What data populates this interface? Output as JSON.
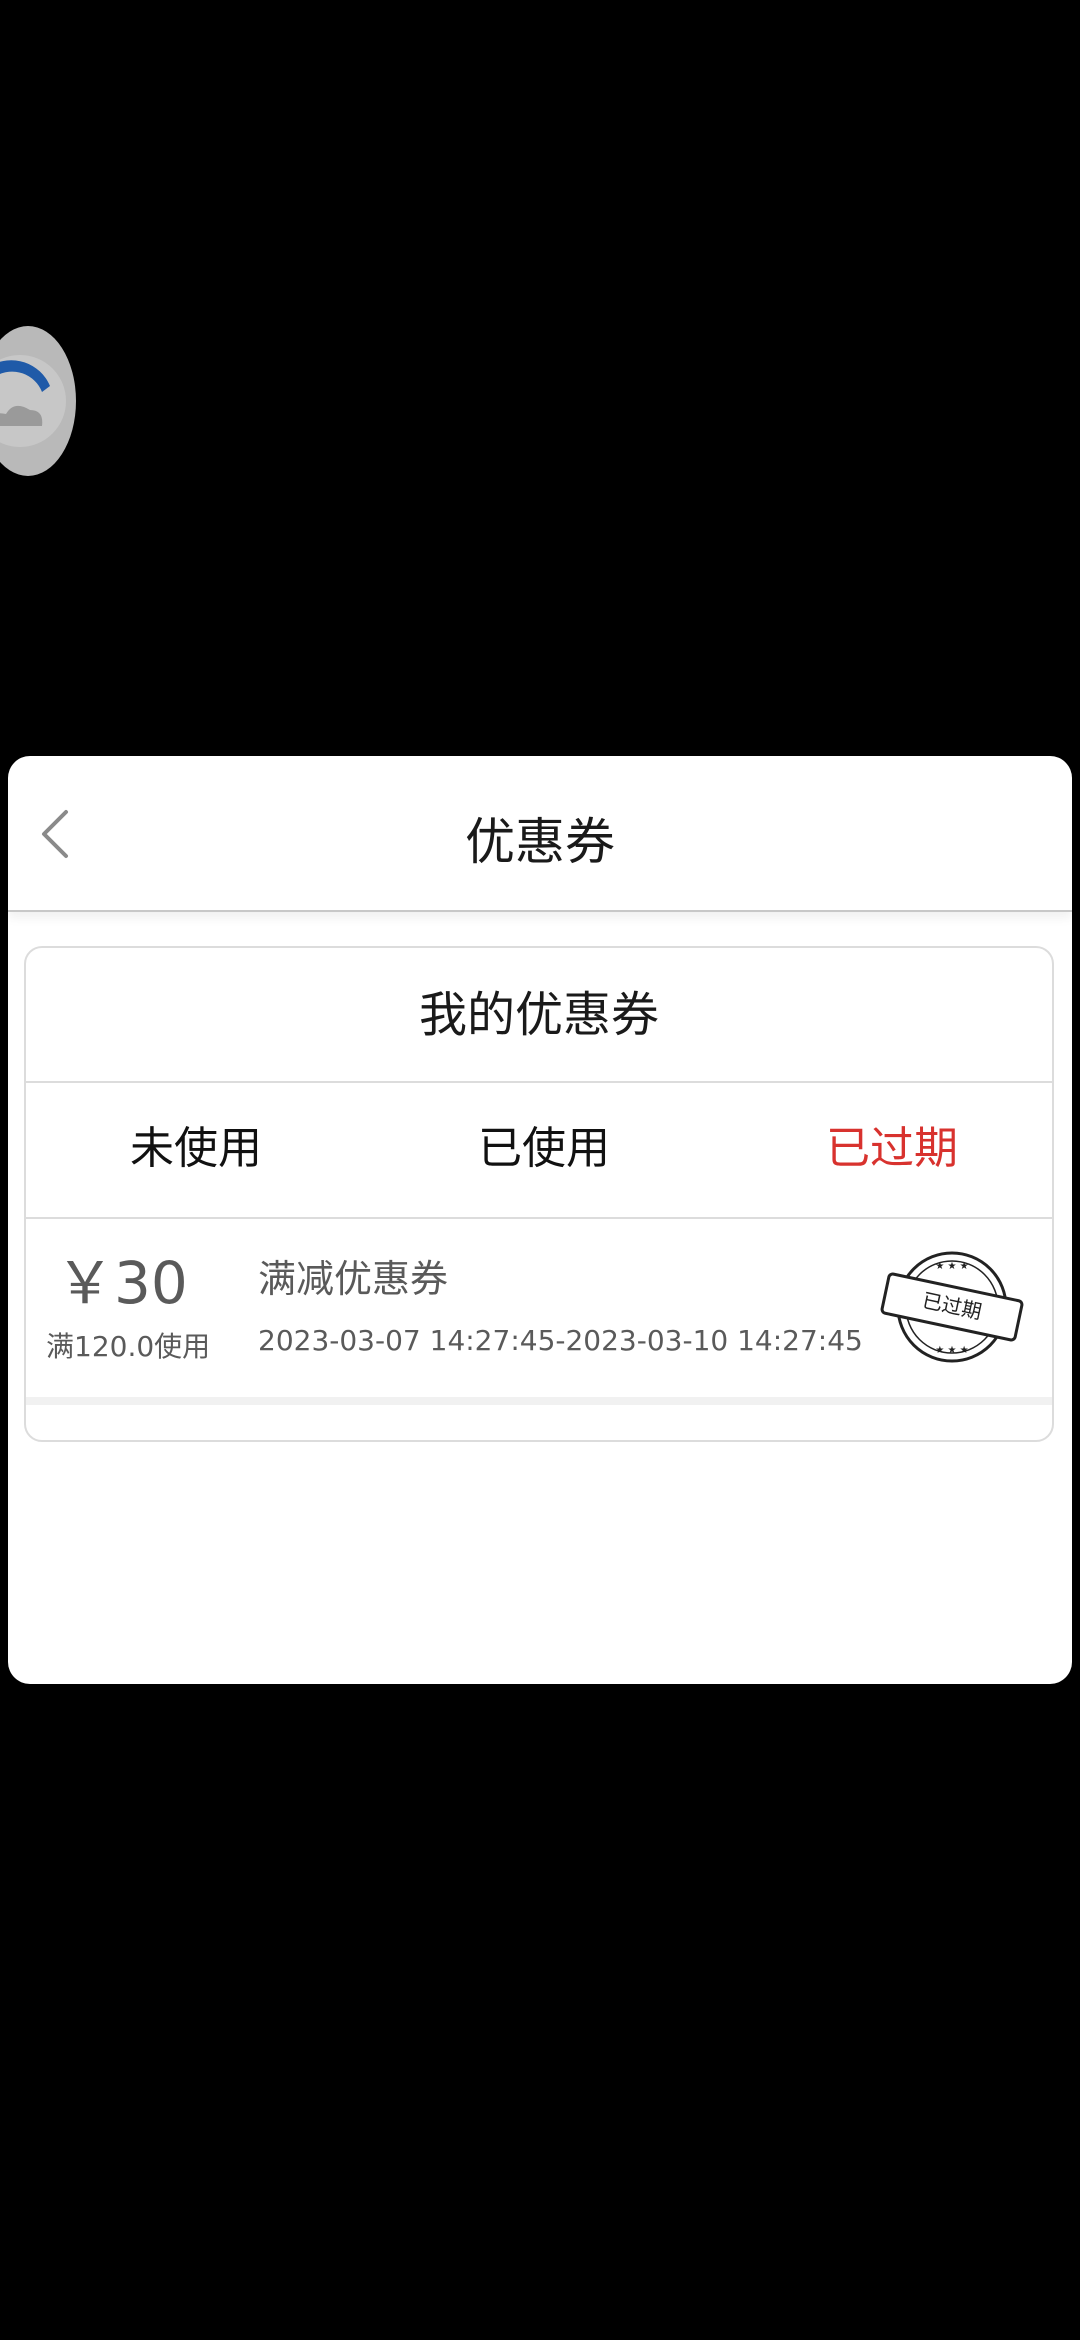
{
  "header": {
    "title": "优惠券"
  },
  "card": {
    "title": "我的优惠券"
  },
  "tabs": [
    {
      "label": "未使用",
      "active": false
    },
    {
      "label": "已使用",
      "active": false
    },
    {
      "label": "已过期",
      "active": true
    }
  ],
  "coupons": [
    {
      "amount": "￥30",
      "condition": "满120.0使用",
      "name": "满减优惠券",
      "period": "2023-03-07 14:27:45-2023-03-10 14:27:45",
      "stamp": "已过期"
    }
  ],
  "colors": {
    "active_tab": "#d8322e",
    "text_primary": "#1a1a1a",
    "text_muted": "#5a5a5a",
    "divider": "#dcdcdc",
    "backdrop": "#000000"
  }
}
